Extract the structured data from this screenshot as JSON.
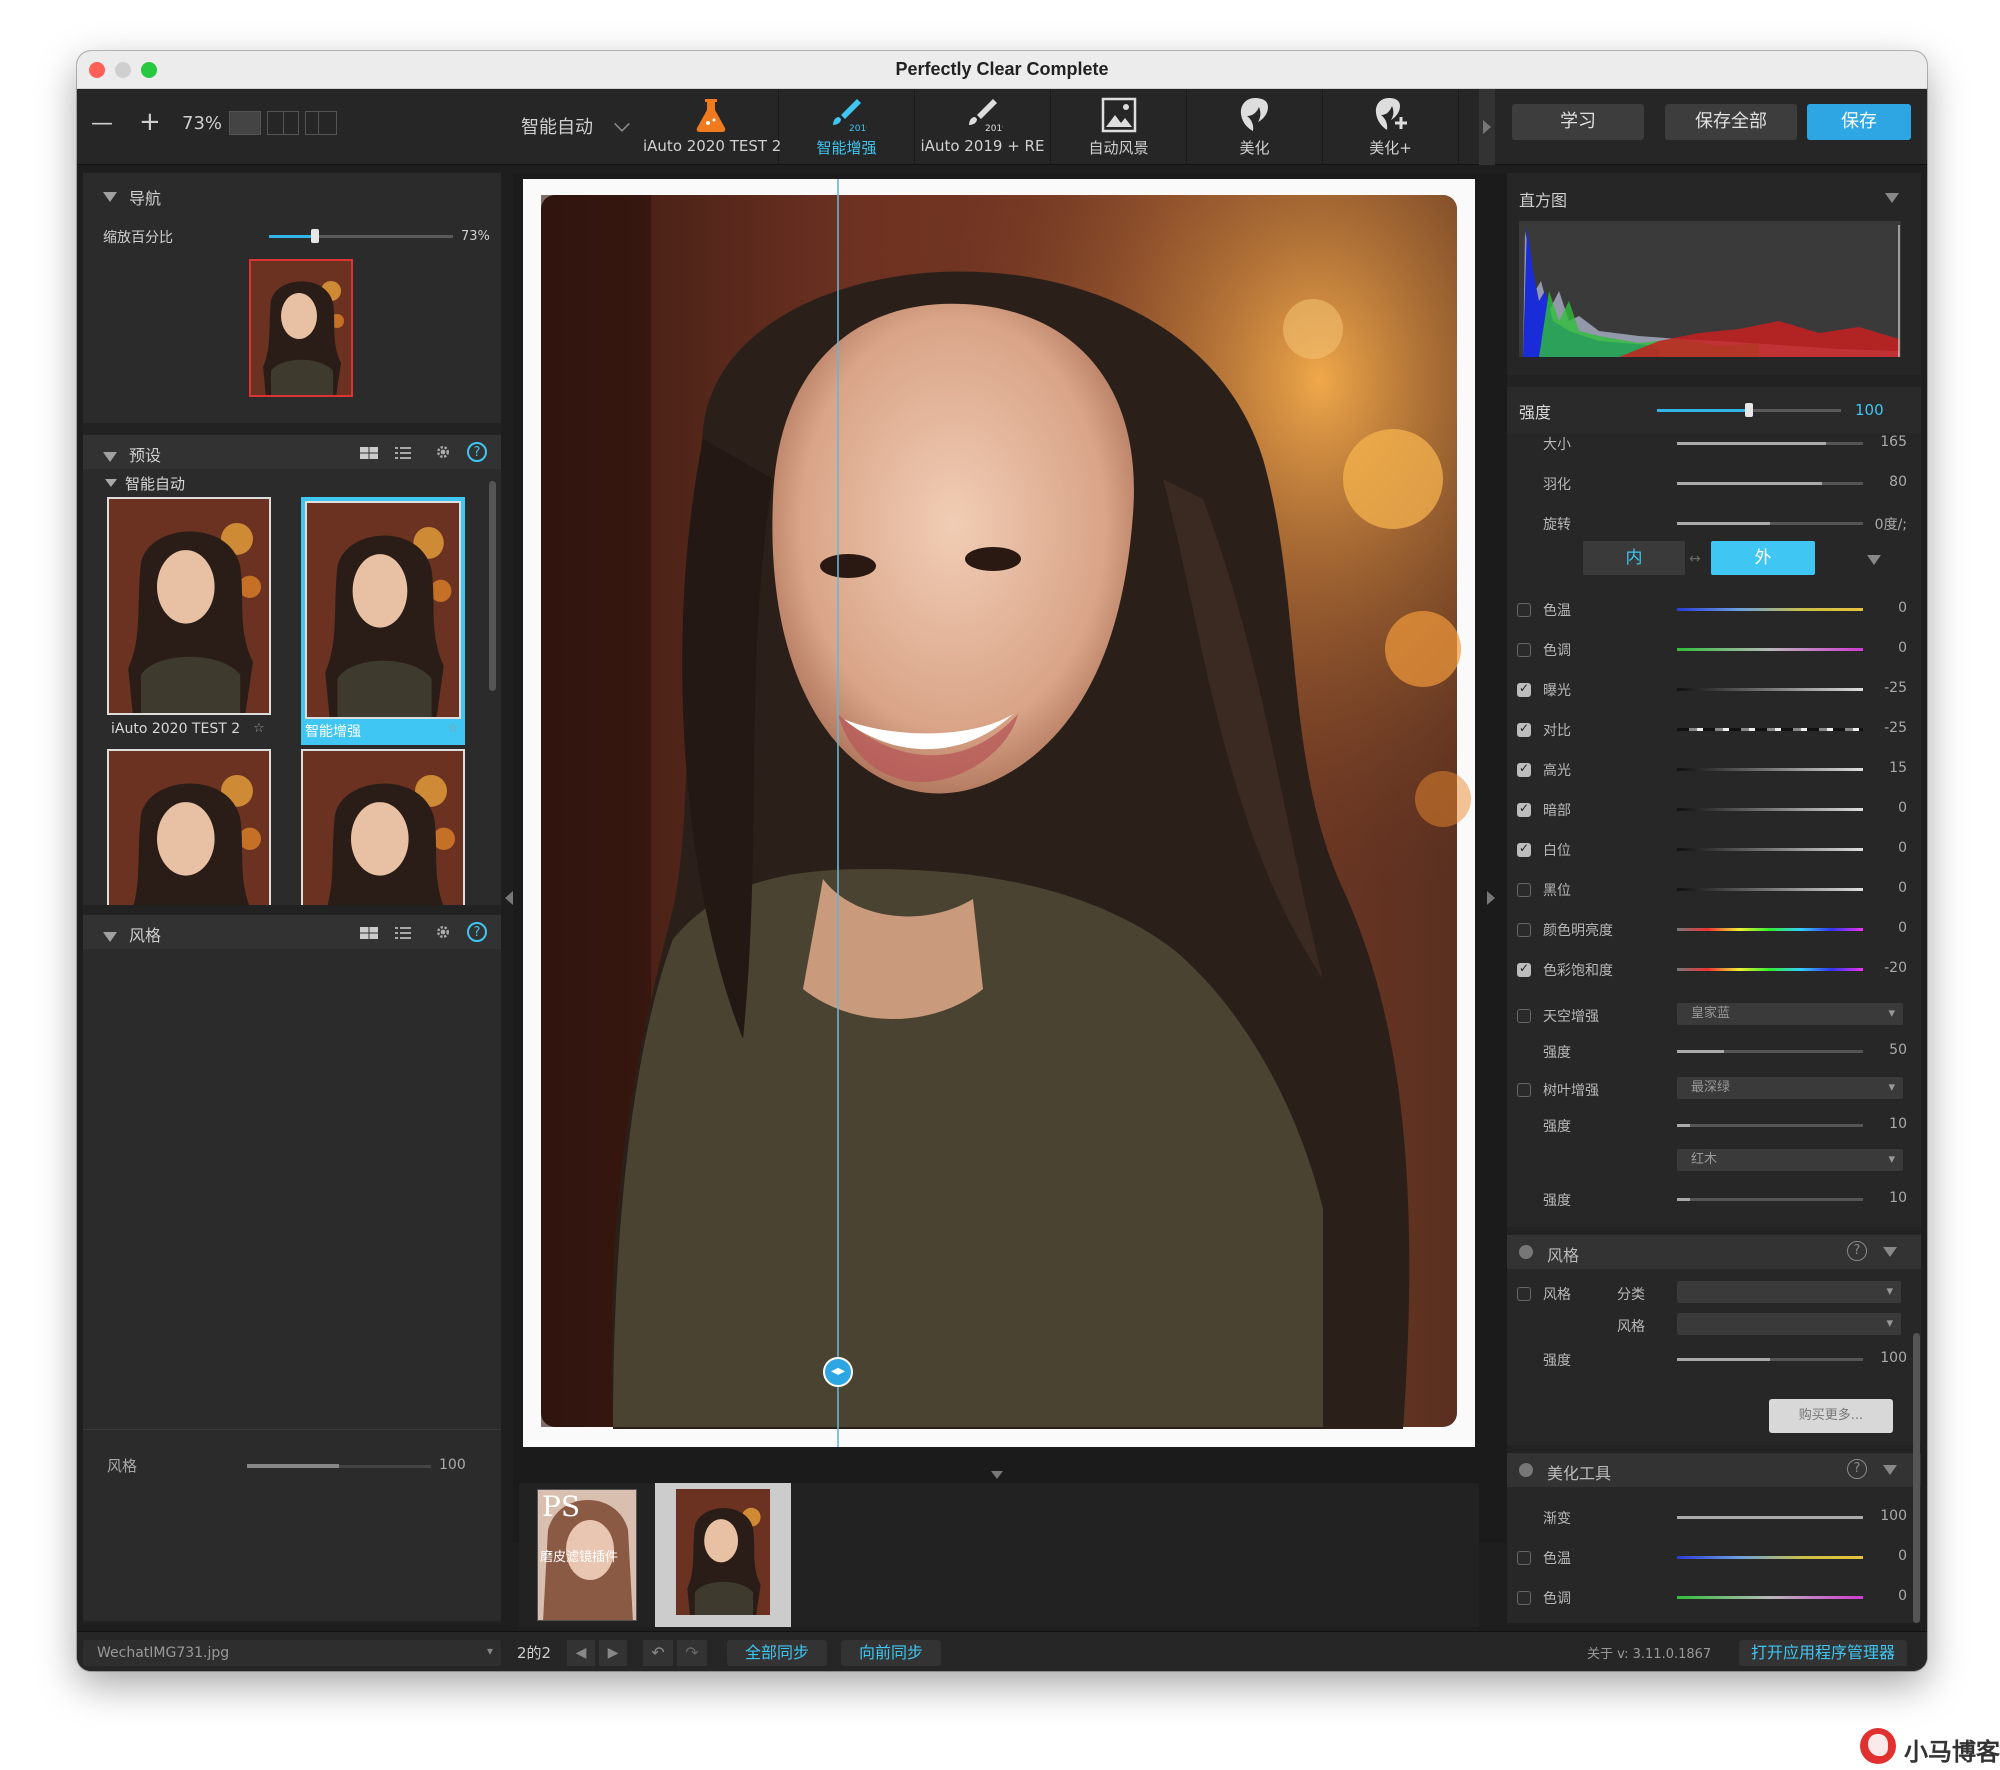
{
  "window": {
    "title": "Perfectly Clear Complete",
    "colors": {
      "accent": "#2ea6e3",
      "bg": "#1e1e1e",
      "panel": "#2b2b2b"
    }
  },
  "toolbar": {
    "zoom_out": "—",
    "zoom_in": "+",
    "zoom": "73%",
    "preset_select": "智能自动",
    "presets": [
      {
        "label": "iAuto 2020 TEST 2",
        "icon": "flask-icon"
      },
      {
        "label": "智能增强",
        "icon": "brush-2019-icon",
        "active": true
      },
      {
        "label": "iAuto 2019 + RE",
        "icon": "brush-eye-2019-icon"
      },
      {
        "label": "自动风景",
        "icon": "landscape-icon"
      },
      {
        "label": "美化",
        "icon": "face-icon"
      },
      {
        "label": "美化+",
        "icon": "face-plus-icon"
      }
    ],
    "learn": "学习",
    "save_all": "保存全部",
    "save": "保存"
  },
  "navigator": {
    "title": "导航",
    "zoom_label": "缩放百分比",
    "zoom_value": "73%",
    "zoom_fraction": 0.25
  },
  "presets_panel": {
    "title": "预设",
    "group": "智能自动",
    "items": [
      {
        "label": "iAuto 2020 TEST 2"
      },
      {
        "label": "智能增强",
        "selected": true
      },
      {
        "label": "iAuto 2019 + RE"
      },
      {
        "label": "自动风景"
      }
    ]
  },
  "style_panel": {
    "title": "风格",
    "strength_label": "风格",
    "strength_value": "100"
  },
  "histogram": {
    "title": "直方图",
    "strength_label": "强度",
    "strength_value": "100"
  },
  "adjust": {
    "top_rows": [
      {
        "label": "大小",
        "value": "165"
      },
      {
        "label": "羽化",
        "value": "80"
      },
      {
        "label": "旋转",
        "value": "0度/;"
      }
    ],
    "inner": "内",
    "outer": "外",
    "rows": [
      {
        "label": "色温",
        "value": "0",
        "checked": false,
        "kind": "temp"
      },
      {
        "label": "色调",
        "value": "0",
        "checked": false,
        "kind": "tint"
      },
      {
        "label": "曝光",
        "value": "-25",
        "checked": true,
        "kind": "gray"
      },
      {
        "label": "对比",
        "value": "-25",
        "checked": true,
        "kind": "dash"
      },
      {
        "label": "高光",
        "value": "15",
        "checked": true,
        "kind": "gray"
      },
      {
        "label": "暗部",
        "value": "0",
        "checked": true,
        "kind": "gray"
      },
      {
        "label": "白位",
        "value": "0",
        "checked": true,
        "kind": "gray"
      },
      {
        "label": "黑位",
        "value": "0",
        "checked": false,
        "kind": "gray"
      },
      {
        "label": "颜色明亮度",
        "value": "0",
        "checked": false,
        "kind": "rainbow"
      },
      {
        "label": "色彩饱和度",
        "value": "-20",
        "checked": true,
        "kind": "rainbow"
      }
    ],
    "sky": {
      "label": "天空增强",
      "option": "皇家蓝",
      "strength_label": "强度",
      "strength_value": "50"
    },
    "foliage": {
      "label": "树叶增强",
      "option": "最深绿",
      "strength_label": "强度",
      "strength_value": "10"
    },
    "wood": {
      "option": "红木",
      "strength_label": "强度",
      "strength_value": "10"
    }
  },
  "style_section": {
    "title": "风格",
    "style_label": "风格",
    "category_label": "分类",
    "style2_label": "风格",
    "strength_label": "强度",
    "strength_value": "100",
    "buy_more": "购买更多..."
  },
  "beauty_section": {
    "title": "美化工具",
    "rows": [
      {
        "label": "渐变",
        "value": "100"
      },
      {
        "label": "色温",
        "value": "0"
      },
      {
        "label": "色调",
        "value": "0"
      }
    ]
  },
  "filmstrip": {
    "items": [
      {
        "overlay": "PS",
        "caption": "磨皮滤镜插件"
      },
      {
        "overlay": "",
        "caption": ""
      }
    ]
  },
  "statusbar": {
    "filename": "WechatIMG731.jpg",
    "counter": "2的2",
    "sync_all": "全部同步",
    "sync_forward": "向前同步",
    "version": "关于 v: 3.11.0.1867",
    "app_manager": "打开应用程序管理器"
  },
  "watermark": {
    "text": "小马博客"
  }
}
